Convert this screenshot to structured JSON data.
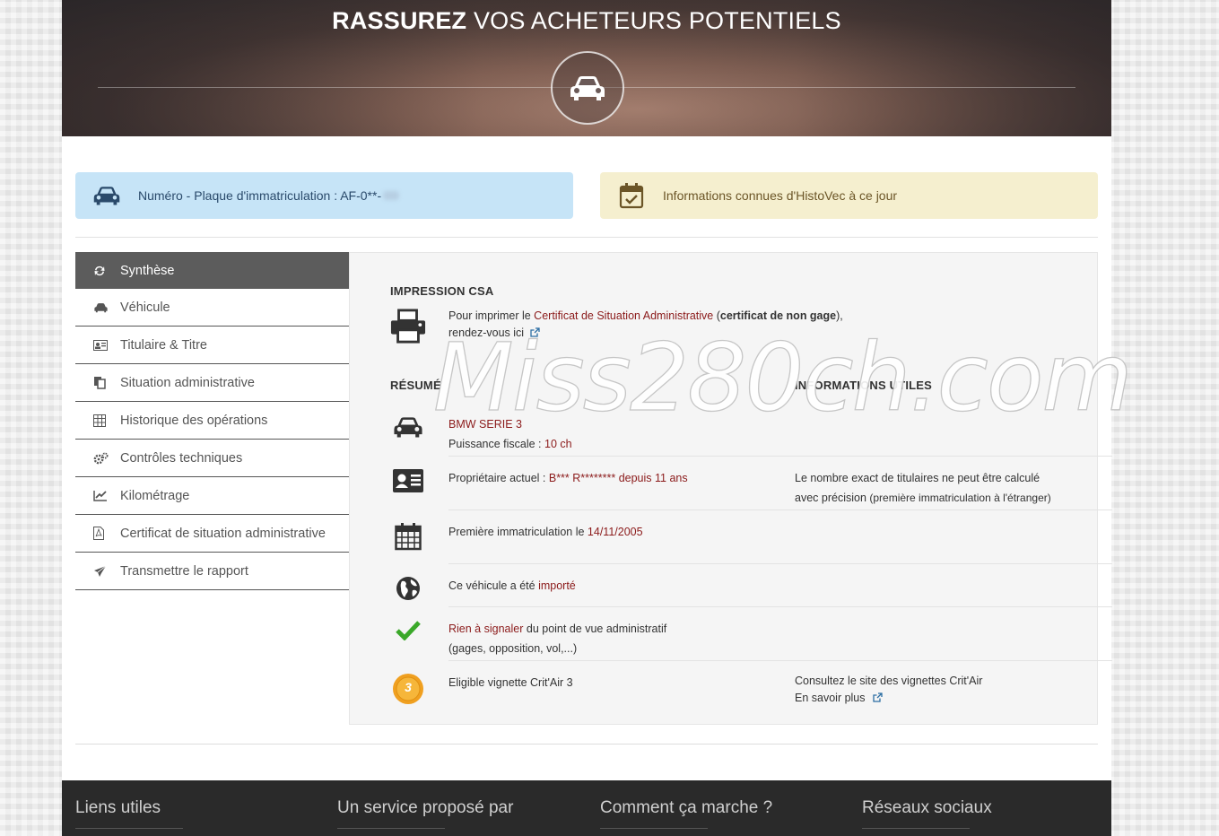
{
  "hero": {
    "title_bold": "RASSUREZ",
    "title_rest": " VOS ACHETEURS POTENTIELS"
  },
  "plate_box": {
    "text": "Numéro - Plaque d'immatriculation : AF-0**-",
    "icon": "car-icon"
  },
  "histo_box": {
    "text": "Informations connues d'HistoVec à ce jour",
    "icon": "calendar-check-icon"
  },
  "sidebar": {
    "items": [
      {
        "label": "Synthèse",
        "icon": "refresh-icon"
      },
      {
        "label": "Véhicule",
        "icon": "car-icon"
      },
      {
        "label": "Titulaire & Titre",
        "icon": "id-card-icon"
      },
      {
        "label": "Situation administrative",
        "icon": "copy-icon"
      },
      {
        "label": "Historique des opérations",
        "icon": "table-icon"
      },
      {
        "label": "Contrôles techniques",
        "icon": "gears-icon"
      },
      {
        "label": "Kilométrage",
        "icon": "line-chart-icon"
      },
      {
        "label": "Certificat de situation administrative",
        "icon": "pdf-file-icon"
      },
      {
        "label": "Transmettre le rapport",
        "icon": "paper-plane-icon"
      }
    ]
  },
  "csa": {
    "title": "IMPRESSION CSA",
    "text_before": "Pour imprimer le ",
    "text_link": "Certificat de Situation Administrative",
    "text_mid": " (",
    "text_bold": "certificat de non gage",
    "text_after": "),",
    "link": "rendez-vous ici"
  },
  "resume": {
    "title": "RÉSUMÉ",
    "side_title": "INFORMATIONS UTILES",
    "vehicle": {
      "model": "BMW SERIE 3",
      "power_label": "Puissance fiscale : ",
      "power_value": "10 ch"
    },
    "owner": {
      "label": "Propriétaire actuel : ",
      "name": "B*** R********",
      "since": " depuis 11 ans",
      "side_line1": "Le nombre exact de titulaires ne peut être calculé",
      "side_line2a": "avec précision ",
      "side_line2b": "(première immatriculation à l'étranger)"
    },
    "first_reg": {
      "label": "Première immatriculation le ",
      "date": "14/11/2005"
    },
    "imported": {
      "label": "Ce véhicule a été ",
      "value": "importé"
    },
    "admin": {
      "value": "Rien à signaler",
      "label": " du point de vue administratif",
      "line2": "(gages, opposition, vol,...)"
    },
    "critair": {
      "badge": "3",
      "label": "Eligible vignette Crit'Air 3",
      "side_line1": "Consultez le site des vignettes Crit'Air",
      "side_link": "En savoir plus"
    }
  },
  "footer": {
    "cols": [
      "Liens utiles",
      "Un service proposé par",
      "Comment ça marche ?",
      "Réseaux sociaux"
    ]
  },
  "watermark": "Miss280ch.com",
  "colors": {
    "accent_red": "#8b1a1a",
    "link_blue": "#2c6ea3",
    "plate_bg": "#c6e4f7",
    "histo_bg": "#f5efcf",
    "active_bg": "#5c5c5c",
    "check_green": "#3aa829",
    "critair_orange": "#f0a020"
  }
}
